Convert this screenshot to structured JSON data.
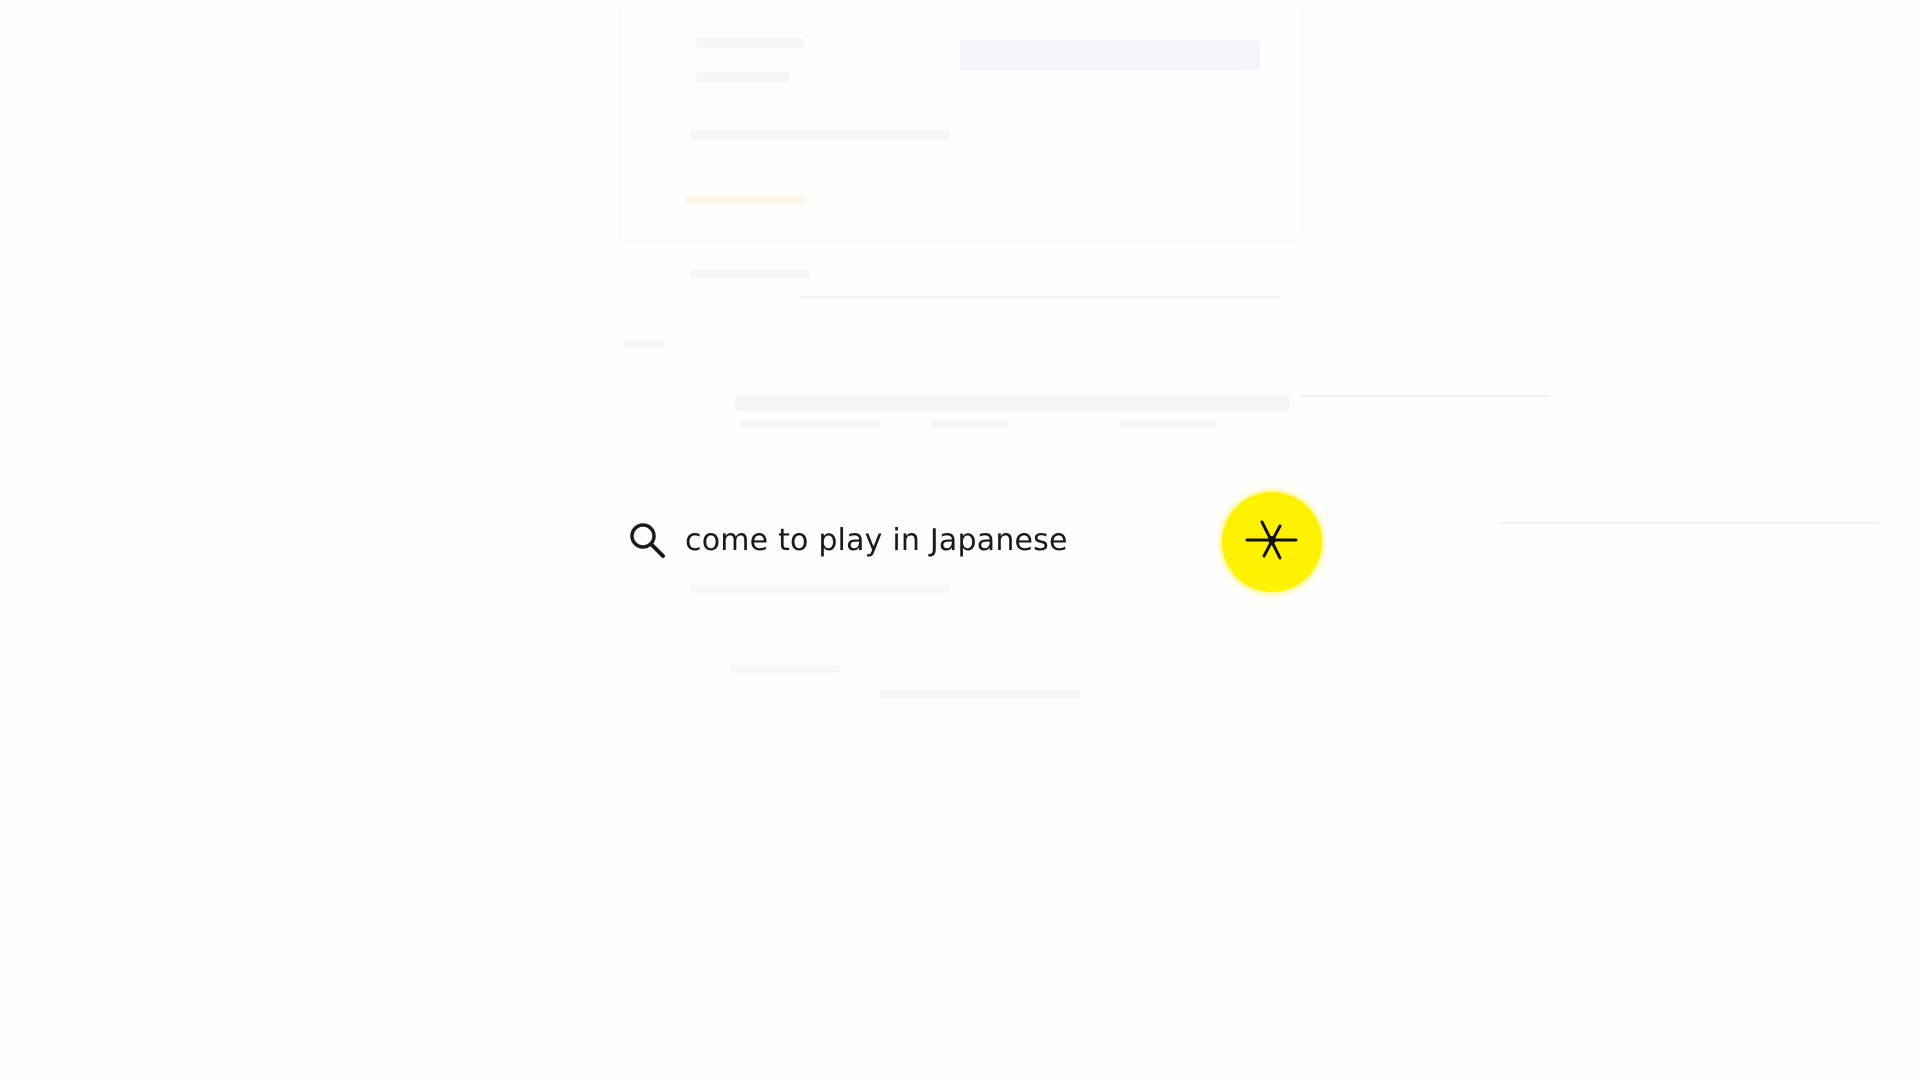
{
  "search": {
    "query": "come to play in Japanese",
    "icon": "search-icon"
  },
  "cursor": {
    "icon": "click-cursor-icon",
    "highlight_color": "#fff200"
  },
  "colors": {
    "background": "#fefefe",
    "text": "#1a1a1a"
  }
}
